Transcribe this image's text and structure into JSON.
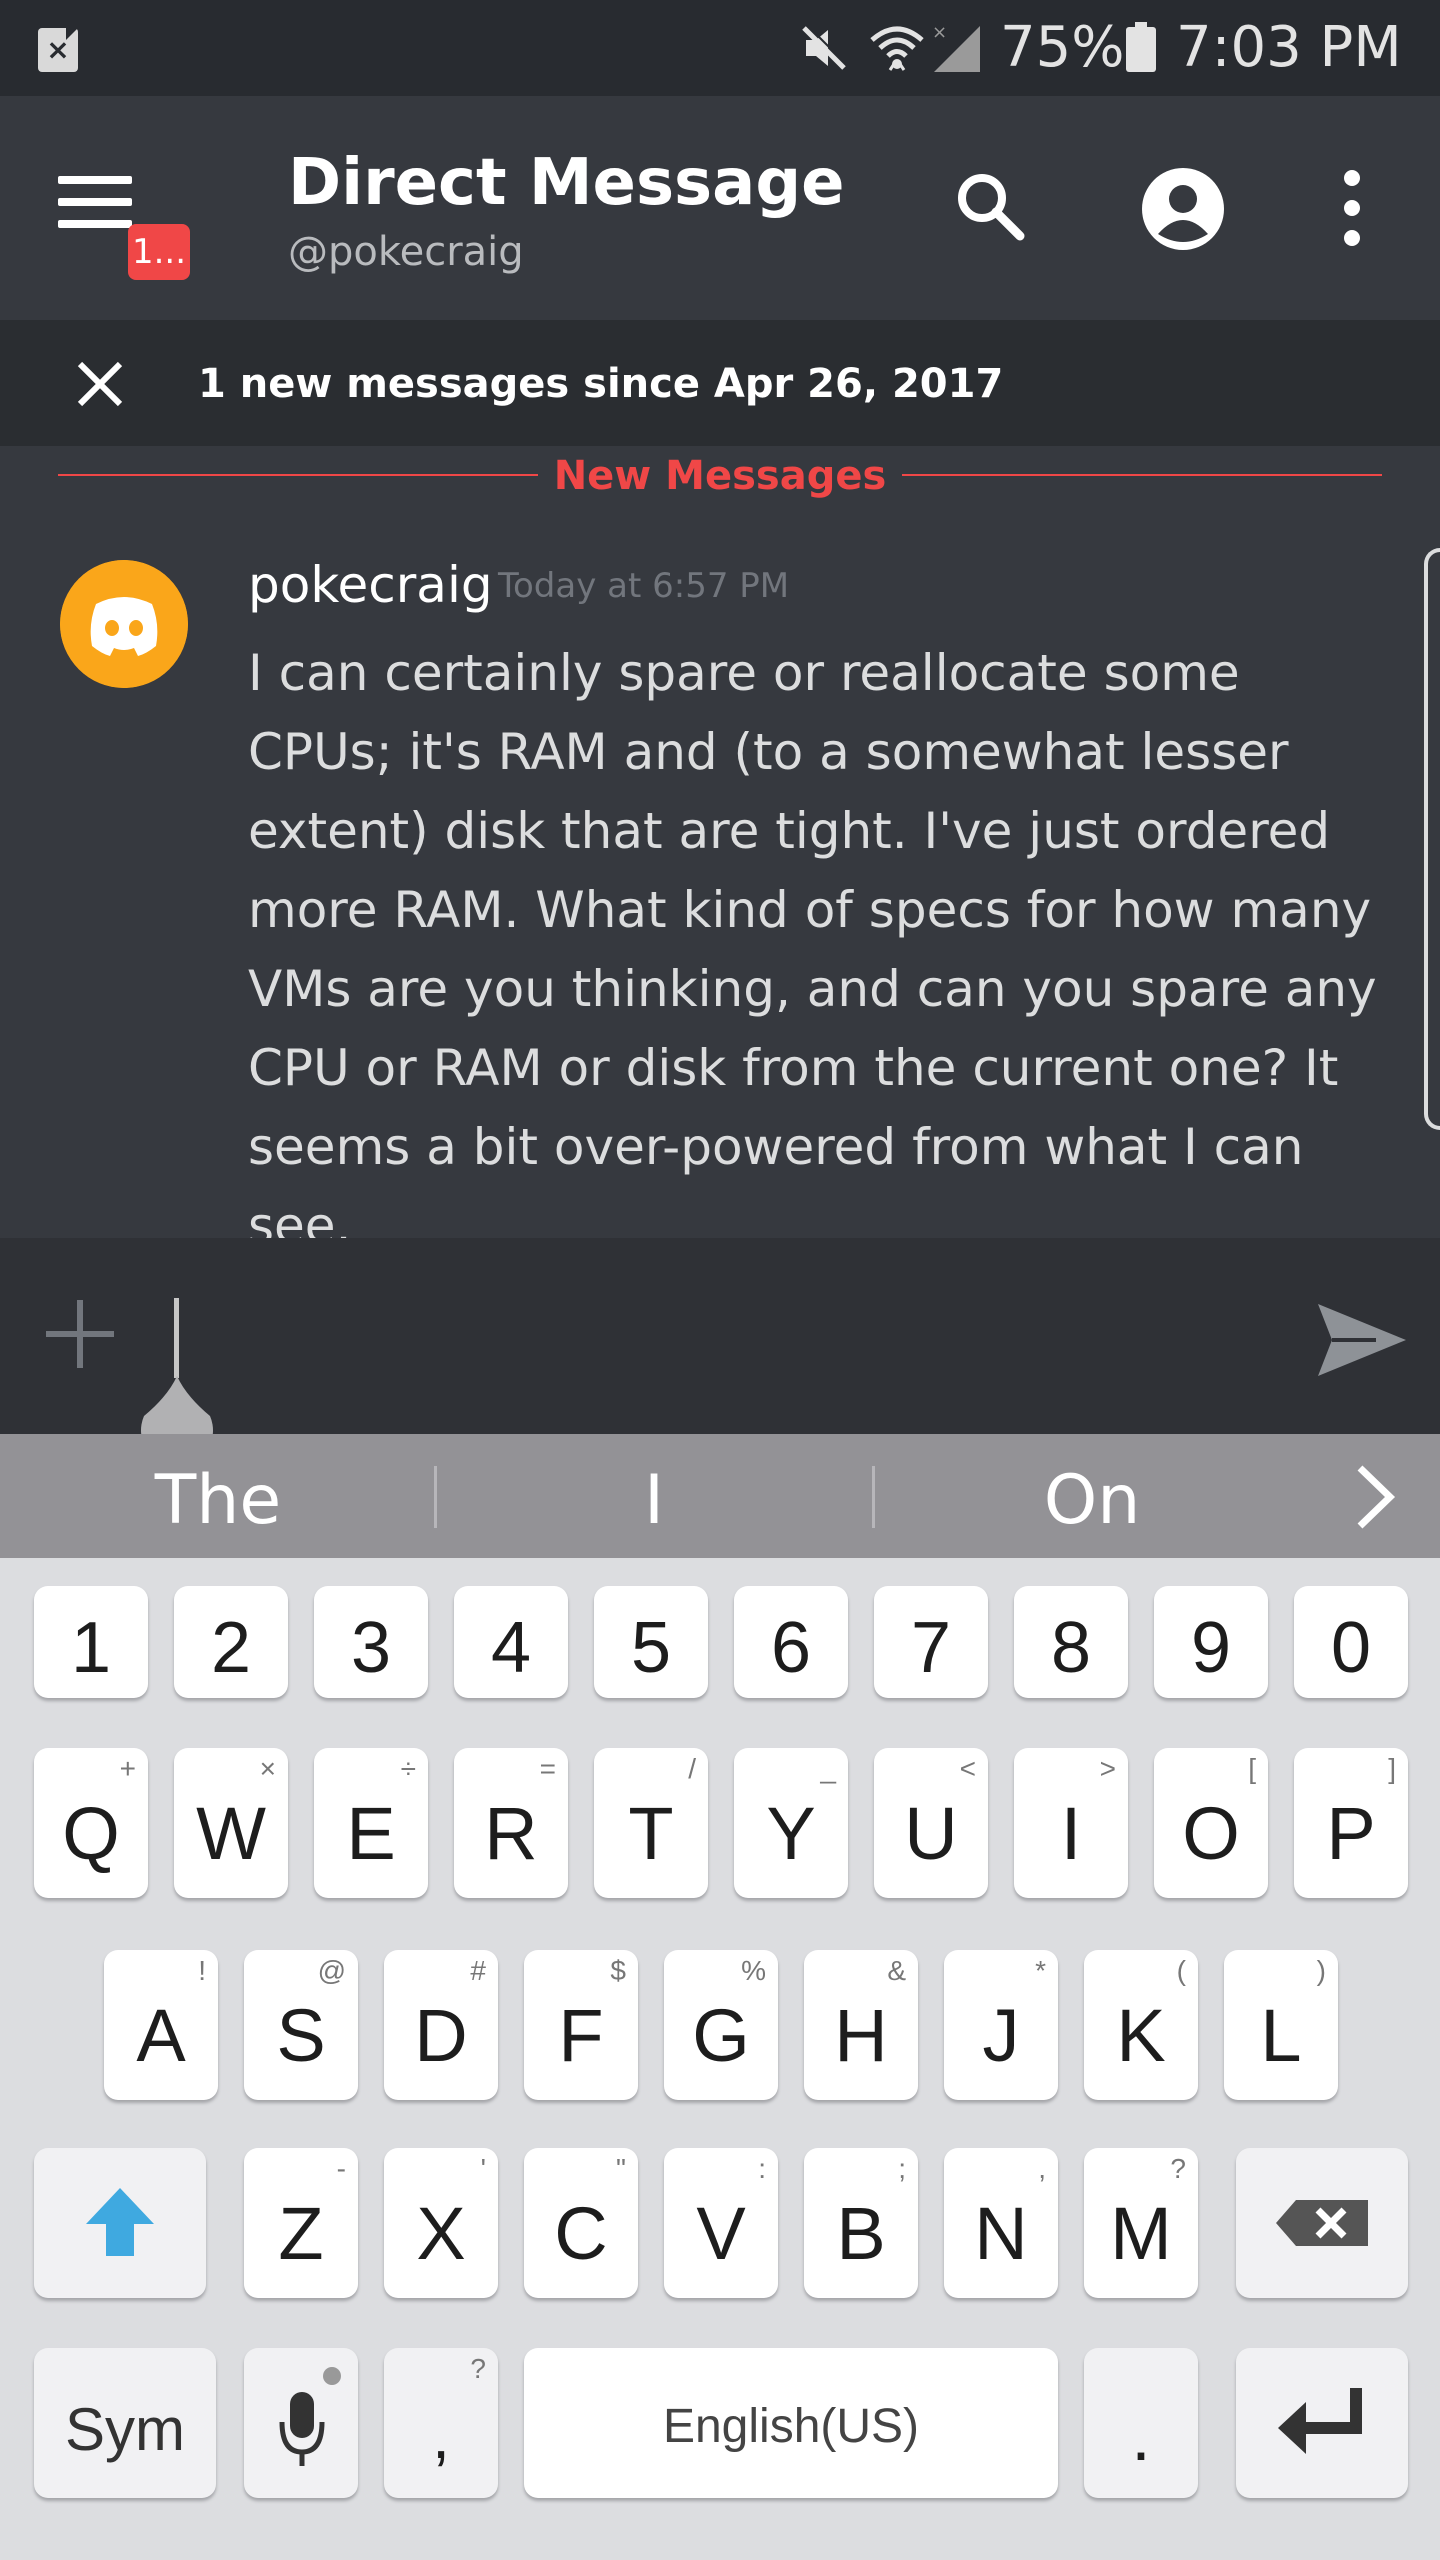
{
  "status_bar": {
    "battery_percent": "75%",
    "time": "7:03 PM",
    "notification_icon": "notification-x-icon"
  },
  "header": {
    "title": "Direct Message",
    "subtitle": "@pokecraig",
    "unread_badge": "1..."
  },
  "new_messages_bar": {
    "text": "1 new messages since Apr 26, 2017"
  },
  "divider": {
    "label": "New Messages"
  },
  "message": {
    "author": "pokecraig",
    "timestamp": "Today at 6:57 PM",
    "text": "I can certainly spare or reallocate some CPUs; it's RAM and (to a somewhat lesser extent) disk that are tight. I've just ordered more RAM. What kind of specs for how many VMs are you thinking, and can you spare any CPU or RAM or disk from the current one? It seems a bit over-powered from what I can see."
  },
  "suggestions": [
    "The",
    "I",
    "On"
  ],
  "keyboard": {
    "number_row": [
      "1",
      "2",
      "3",
      "4",
      "5",
      "6",
      "7",
      "8",
      "9",
      "0"
    ],
    "row1": [
      {
        "main": "Q",
        "sub": "+"
      },
      {
        "main": "W",
        "sub": "×"
      },
      {
        "main": "E",
        "sub": "÷"
      },
      {
        "main": "R",
        "sub": "="
      },
      {
        "main": "T",
        "sub": "/"
      },
      {
        "main": "Y",
        "sub": "_"
      },
      {
        "main": "U",
        "sub": "<"
      },
      {
        "main": "I",
        "sub": ">"
      },
      {
        "main": "O",
        "sub": "["
      },
      {
        "main": "P",
        "sub": "]"
      }
    ],
    "row2": [
      {
        "main": "A",
        "sub": "!"
      },
      {
        "main": "S",
        "sub": "@"
      },
      {
        "main": "D",
        "sub": "#"
      },
      {
        "main": "F",
        "sub": "$"
      },
      {
        "main": "G",
        "sub": "%"
      },
      {
        "main": "H",
        "sub": "&"
      },
      {
        "main": "J",
        "sub": "*"
      },
      {
        "main": "K",
        "sub": "("
      },
      {
        "main": "L",
        "sub": ")"
      }
    ],
    "row3": [
      {
        "main": "Z",
        "sub": "-"
      },
      {
        "main": "X",
        "sub": "'"
      },
      {
        "main": "C",
        "sub": "\""
      },
      {
        "main": "V",
        "sub": ":"
      },
      {
        "main": "B",
        "sub": ";"
      },
      {
        "main": "N",
        "sub": ","
      },
      {
        "main": "M",
        "sub": "?"
      }
    ],
    "sym_label": "Sym",
    "comma": {
      "main": ",",
      "sub": "?"
    },
    "space_label": "English(US)",
    "period": "."
  },
  "colors": {
    "background": "#36393f",
    "status_bar": "#282b30",
    "accent_red": "#f04747",
    "avatar": "#faa61a",
    "shift_blue": "#3fa9e0"
  }
}
